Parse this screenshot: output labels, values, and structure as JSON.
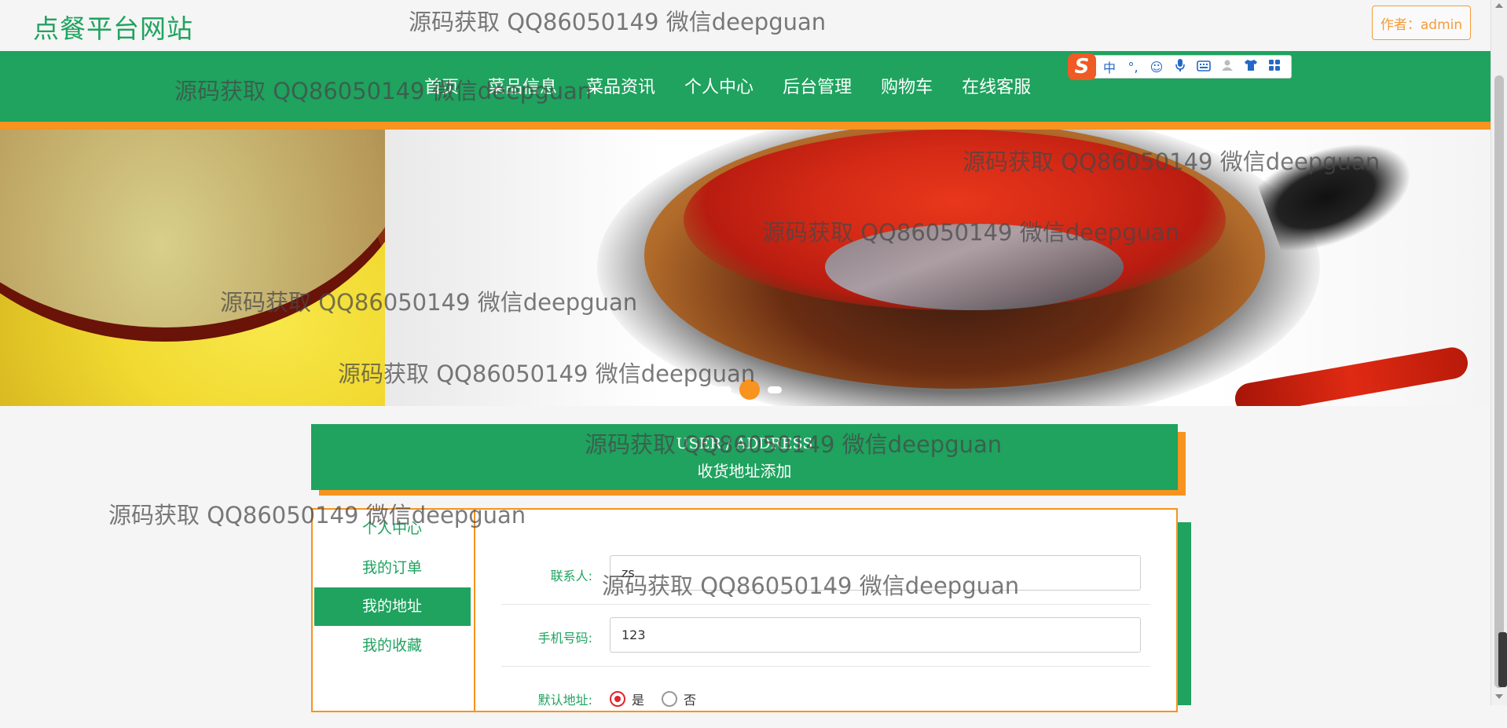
{
  "header": {
    "site_title": "点餐平台网站",
    "author_label": "作者：admin"
  },
  "nav": {
    "items": [
      "首页",
      "菜品信息",
      "菜品资讯",
      "个人中心",
      "后台管理",
      "购物车",
      "在线客服"
    ]
  },
  "ime_toolbar": {
    "logo": "S",
    "items": [
      "中",
      "°,",
      "☺",
      "mic-icon",
      "keyboard-icon",
      "user-icon",
      "shirt-icon",
      "grid-icon"
    ]
  },
  "banner": {
    "slides": 3,
    "active_slide": 2
  },
  "section": {
    "title_en": "USER / ADDRESS",
    "title_zh": "收货地址添加"
  },
  "sidebar": {
    "items": [
      {
        "label": "个人中心",
        "active": false
      },
      {
        "label": "我的订单",
        "active": false
      },
      {
        "label": "我的地址",
        "active": true
      },
      {
        "label": "我的收藏",
        "active": false
      }
    ]
  },
  "form": {
    "contact_label": "联系人:",
    "contact_value": "zs",
    "phone_label": "手机号码:",
    "phone_value": "123",
    "default_label": "默认地址:",
    "default_options": [
      "是",
      "否"
    ],
    "default_selected": "是"
  },
  "watermark": {
    "text": "源码获取 QQ86050149 微信deepguan"
  },
  "colors": {
    "primary_green": "#1fa35f",
    "accent_orange": "#f7931e",
    "radio_red": "#e0262e"
  }
}
